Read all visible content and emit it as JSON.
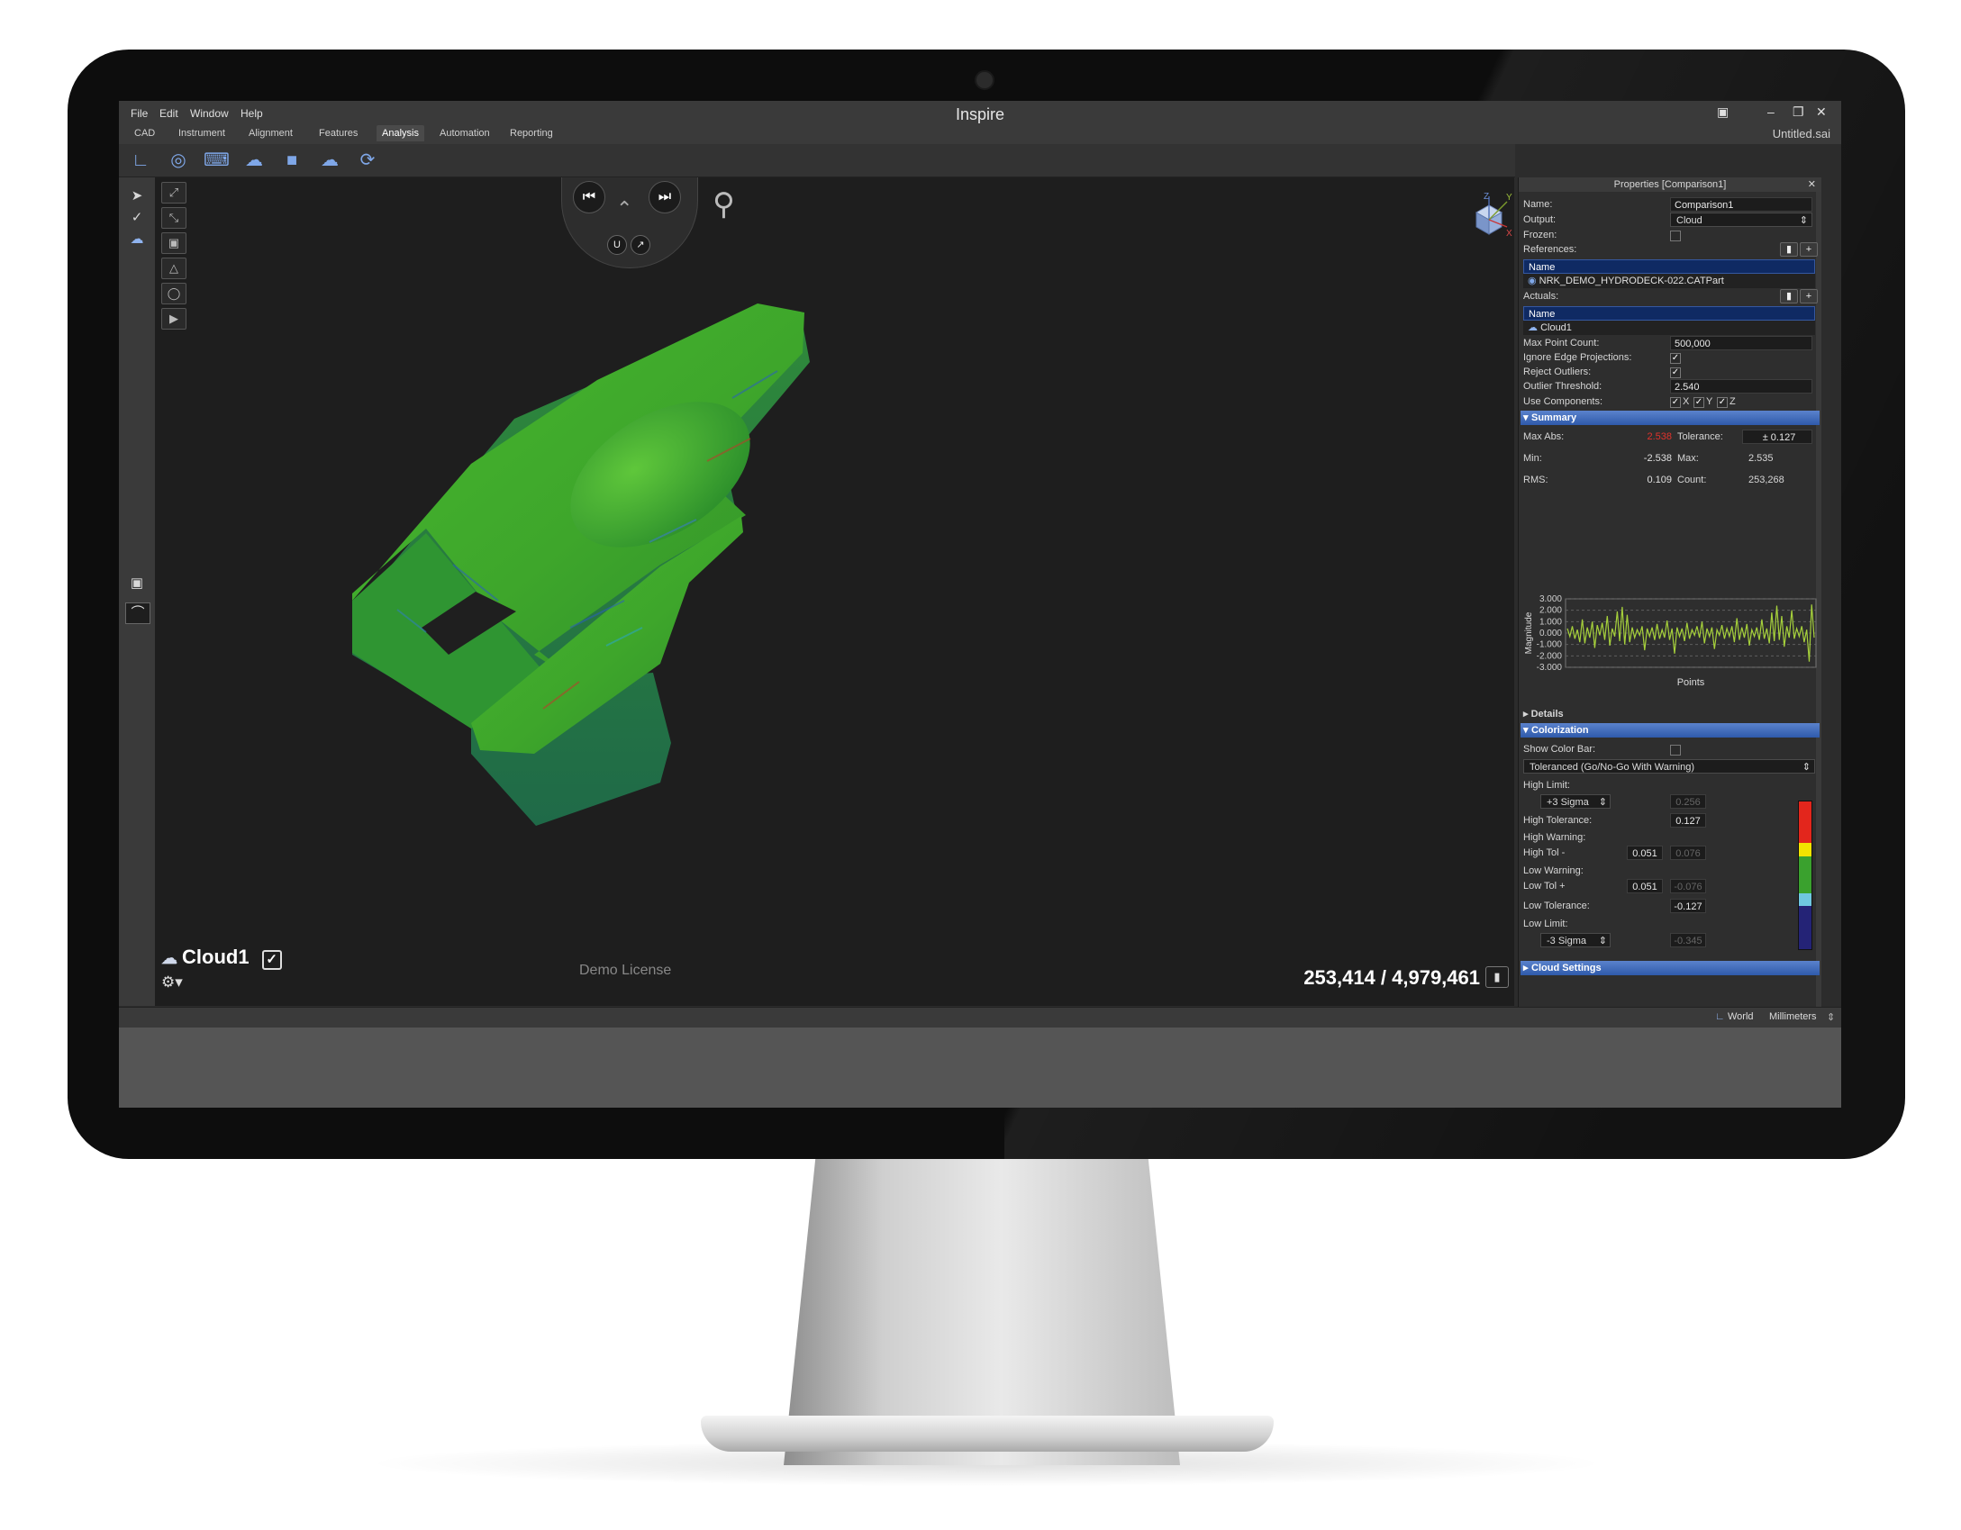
{
  "menu": [
    "File",
    "Edit",
    "Window",
    "Help"
  ],
  "app_title": "Inspire",
  "window_controls": [
    "save-icon",
    "minimize-icon",
    "restore-icon",
    "close-icon"
  ],
  "tabs": [
    {
      "label": "CAD",
      "active": false
    },
    {
      "label": "Instrument",
      "active": false
    },
    {
      "label": "Alignment",
      "active": false
    },
    {
      "label": "Features",
      "active": false
    },
    {
      "label": "Analysis",
      "active": true
    },
    {
      "label": "Automation",
      "active": false
    },
    {
      "label": "Reporting",
      "active": false
    }
  ],
  "document_name": "Untitled.sai",
  "toolbar_icons": [
    "axes-icon",
    "sphere-scan-icon",
    "probe-arm-icon",
    "cloud-compare-icon",
    "cube-icon",
    "cloud-icon",
    "refresh-target-icon"
  ],
  "viewport": {
    "cloud_name": "Cloud1",
    "cloud_checked": true,
    "demo_license": "Demo License",
    "point_count": "253,414 / 4,979,461",
    "axes": {
      "x": "X",
      "y": "Y",
      "z": "Z"
    }
  },
  "properties": {
    "title": "Properties [Comparison1]",
    "name_label": "Name:",
    "name_value": "Comparison1",
    "output_label": "Output:",
    "output_value": "Cloud",
    "frozen_label": "Frozen:",
    "references_label": "References:",
    "list_header": "Name",
    "reference_item": "NRK_DEMO_HYDRODECK-022.CATPart",
    "actuals_label": "Actuals:",
    "actual_item": "Cloud1",
    "max_point_label": "Max Point Count:",
    "max_point_value": "500,000",
    "ignore_edge_label": "Ignore Edge Projections:",
    "reject_outliers_label": "Reject Outliers:",
    "outlier_threshold_label": "Outlier Threshold:",
    "outlier_threshold_value": "2.540",
    "use_components_label": "Use Components:",
    "components": [
      "X",
      "Y",
      "Z"
    ]
  },
  "summary": {
    "title": "Summary",
    "max_abs_label": "Max Abs:",
    "max_abs_value": "2.538",
    "tolerance_label": "Tolerance:",
    "tolerance_value": "± 0.127",
    "min_label": "Min:",
    "min_value": "-2.538",
    "max_label": "Max:",
    "max_value": "2.535",
    "rms_label": "RMS:",
    "rms_value": "0.109",
    "count_label": "Count:",
    "count_value": "253,268",
    "details_label": "Details"
  },
  "chart_data": {
    "type": "line",
    "xlabel": "Points",
    "ylabel": "Magnitude",
    "ylim": [
      -3.0,
      3.0
    ],
    "yticks": [
      "3.000",
      "2.000",
      "1.000",
      "0.000",
      "-1.000",
      "-2.000",
      "-3.000"
    ],
    "grid": true,
    "color": "#a6d13b",
    "series": [
      {
        "values": [
          0.4,
          -0.3,
          0.6,
          -0.5,
          0.3,
          -0.8,
          1.2,
          -0.9,
          0.5,
          -0.4,
          1.0,
          -1.3,
          0.7,
          -0.2,
          0.9,
          -0.6,
          1.5,
          -1.1,
          0.4,
          -0.3,
          1.9,
          -0.7,
          2.3,
          -1.0,
          1.6,
          -0.8,
          0.5,
          -0.4,
          0.3,
          -0.2,
          0.6,
          -1.5,
          0.4,
          -0.3,
          0.5,
          -0.6,
          0.8,
          -0.5,
          0.3,
          -0.4,
          1.1,
          -0.6,
          0.4,
          -1.8,
          0.5,
          -0.3,
          0.4,
          -0.7,
          0.9,
          -0.5,
          0.3,
          -0.2,
          0.6,
          -0.4,
          1.0,
          -0.9,
          0.4,
          -0.3,
          0.5,
          -1.4,
          0.3,
          -0.2,
          0.7,
          -0.5,
          0.4,
          -0.3,
          0.6,
          -0.8,
          1.3,
          -0.6,
          0.5,
          -0.4,
          0.8,
          -1.1,
          0.3,
          -0.3,
          0.5,
          -0.6,
          1.2,
          -0.5,
          0.4,
          -0.9,
          1.8,
          -0.7,
          2.4,
          -0.6,
          1.5,
          -1.2,
          0.6,
          -0.4,
          2.0,
          -0.5,
          0.4,
          -0.3,
          0.6,
          -0.8,
          0.3,
          -2.5,
          2.5,
          -0.4
        ]
      }
    ]
  },
  "colorization": {
    "title": "Colorization",
    "show_color_bar_label": "Show Color Bar:",
    "mode": "Toleranced (Go/No-Go With Warning)",
    "high_limit_label": "High Limit:",
    "high_limit_mode": "+3 Sigma",
    "high_limit_value": "0.256",
    "high_tolerance_label": "High Tolerance:",
    "high_tolerance_value": "0.127",
    "high_warning_label": "High Warning:",
    "high_tol_minus_label": "High Tol -",
    "high_tol_minus_value": "0.051",
    "high_warning_value": "0.076",
    "low_warning_label": "Low Warning:",
    "low_tol_plus_label": "Low Tol +",
    "low_tol_plus_value": "0.051",
    "low_warning_value": "-0.076",
    "low_tolerance_label": "Low Tolerance:",
    "low_tolerance_value": "-0.127",
    "low_limit_label": "Low Limit:",
    "low_limit_mode": "-3 Sigma",
    "low_limit_value": "-0.345",
    "colors": {
      "red": "#e3261c",
      "yellow": "#f2e300",
      "green": "#3aa12e",
      "cyan": "#6fc7e0",
      "navy": "#242376"
    }
  },
  "cloud_settings_label": "Cloud Settings",
  "status": {
    "frame": "World",
    "units": "Millimeters"
  }
}
